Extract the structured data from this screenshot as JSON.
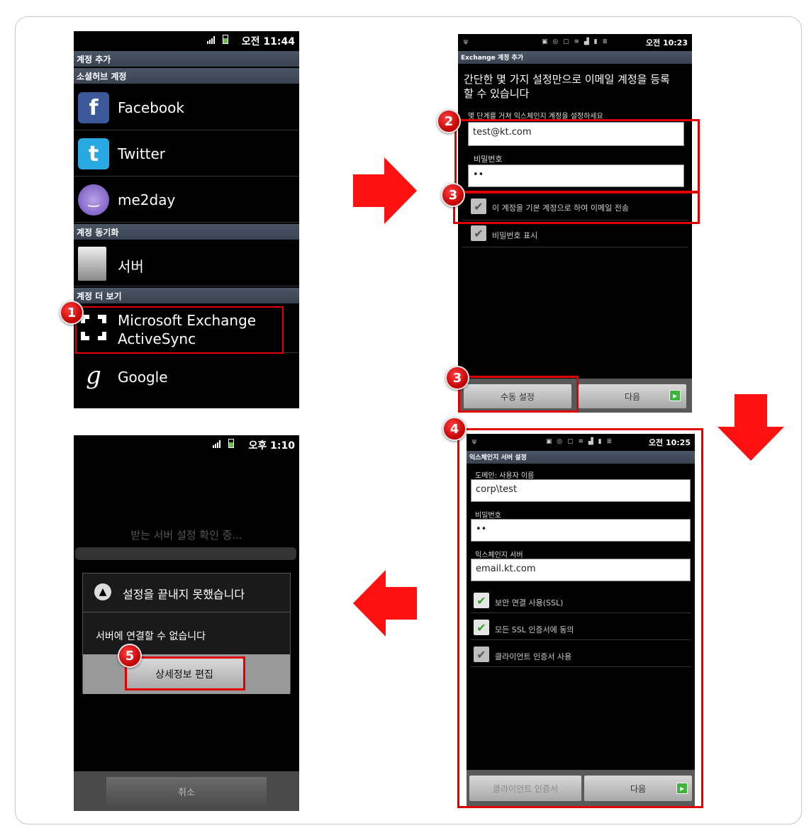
{
  "screen1": {
    "status_time": "오전 11:44",
    "header": "계정 추가",
    "section_social": "소셜허브 계정",
    "items_social": [
      {
        "label": "Facebook",
        "icon": "facebook-icon"
      },
      {
        "label": "Twitter",
        "icon": "twitter-icon"
      },
      {
        "label": "me2day",
        "icon": "me2day-icon"
      }
    ],
    "section_sync": "계정 동기화",
    "item_server": "서버",
    "section_more": "계정 더 보기",
    "exchange_line1": "Microsoft Exchange",
    "exchange_line2": "ActiveSync",
    "item_google": "Google"
  },
  "screen2": {
    "status_time": "오전 10:23",
    "header": "Exchange 계정 추가",
    "intro": "간단한 몇 가지 설정만으로 이메일 계정을 등록할 수 있습니다",
    "sub": "몇 단계를 거쳐 익스체인지 계정을 설정하세요",
    "email_value": "test@kt.com",
    "password_label": "비밀번호",
    "password_value": "••",
    "check_default": "이 계정을 기본 계정으로 하여 이메일 전송",
    "check_show_password": "비밀번호 표시",
    "btn_manual": "수동 설정",
    "btn_next": "다음"
  },
  "screen3": {
    "status_time": "오전 10:25",
    "header": "익스체인지 서버 설정",
    "domain_label": "도메인: 사용자 이름",
    "domain_value": "corp\\test",
    "password_label": "비밀번호",
    "password_value": "••",
    "server_label": "익스체인지 서버",
    "server_value": "email.kt.com",
    "check_ssl": "보안 연결 사용(SSL)",
    "check_accept_ssl": "모든 SSL 인증서에 동의",
    "check_client_cert": "클라이언트 인증서 사용",
    "btn_client_cert": "클라이언트 인증서",
    "btn_next": "다음"
  },
  "screen4": {
    "status_time": "오후 1:10",
    "checking": "받는 서버 설정 확인 중...",
    "dialog_title": "설정을 끝내지 못했습니다",
    "dialog_message": "서버에 연결할 수 없습니다",
    "btn_edit": "상세정보 편집",
    "btn_cancel": "취소"
  },
  "badges": [
    "1",
    "2",
    "3",
    "3",
    "4",
    "5"
  ],
  "colors": {
    "highlight": "#e00000",
    "arrow": "#ff1010",
    "section": "#3f4856"
  }
}
